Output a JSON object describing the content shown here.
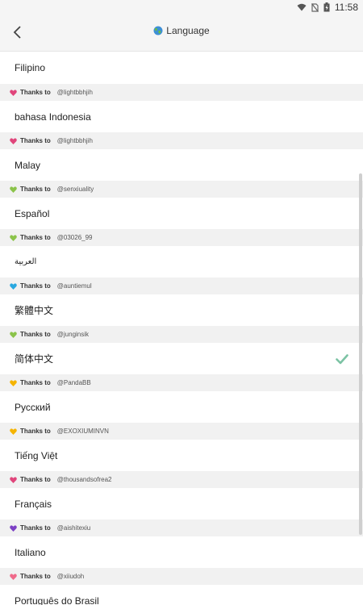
{
  "status": {
    "time": "11:58"
  },
  "header": {
    "title": "Language",
    "back_icon": "back-arrow-icon",
    "globe_icon": "globe-icon"
  },
  "credits_prefix": "Thanks to",
  "languages": [
    {
      "label": "Filipino"
    },
    {
      "label": "bahasa Indonesia",
      "credit": "@lightbbhjih",
      "heart_color": "#e0457b"
    },
    {
      "label": "Malay",
      "credit": "@lightbbhjih",
      "heart_color": "#e0457b"
    },
    {
      "label": "Español",
      "credit": "@senxiuality",
      "heart_color": "#8bc34a"
    },
    {
      "label": "العربية",
      "credit": "@03026_99",
      "heart_color": "#8bc34a"
    },
    {
      "label": "繁體中文",
      "credit": "@auntiemul",
      "heart_color": "#29a8e0"
    },
    {
      "label": "简体中文",
      "credit": "@junginsik",
      "heart_color": "#8bc34a",
      "selected": true
    },
    {
      "label": "Русский",
      "credit": "@PandaBB",
      "heart_color": "#f5b400"
    },
    {
      "label": "Tiếng Việt",
      "credit": "@EXOXIUMINVN",
      "heart_color": "#f5b400"
    },
    {
      "label": "Français",
      "credit": "@thousandsofrea2",
      "heart_color": "#e0457b"
    },
    {
      "label": "Italiano",
      "credit": "@aishitexiu",
      "heart_color": "#7b3fc4"
    },
    {
      "label": "Português do Brasil",
      "credit": "@xiiudoh",
      "heart_color": "#f06a8a"
    }
  ],
  "colors": {
    "check": "#7cc3a4"
  }
}
